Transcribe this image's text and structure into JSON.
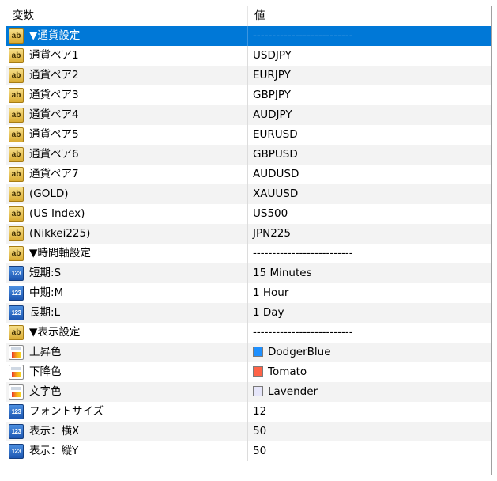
{
  "header": {
    "name_col": "変数",
    "value_col": "値"
  },
  "rows": [
    {
      "icon": "ab-icon",
      "name": "▼通貨設定",
      "value": "--------------------------",
      "selected": true
    },
    {
      "icon": "ab-icon",
      "name": "通貨ペア1",
      "value": "USDJPY"
    },
    {
      "icon": "ab-icon",
      "name": "通貨ペア2",
      "value": "EURJPY"
    },
    {
      "icon": "ab-icon",
      "name": "通貨ペア3",
      "value": "GBPJPY"
    },
    {
      "icon": "ab-icon",
      "name": "通貨ペア4",
      "value": "AUDJPY"
    },
    {
      "icon": "ab-icon",
      "name": "通貨ペア5",
      "value": "EURUSD"
    },
    {
      "icon": "ab-icon",
      "name": "通貨ペア6",
      "value": "GBPUSD"
    },
    {
      "icon": "ab-icon",
      "name": "通貨ペア7",
      "value": "AUDUSD"
    },
    {
      "icon": "ab-icon",
      "name": "(GOLD)",
      "value": "XAUUSD"
    },
    {
      "icon": "ab-icon",
      "name": "(US Index)",
      "value": "US500"
    },
    {
      "icon": "ab-icon",
      "name": "(Nikkei225)",
      "value": "JPN225"
    },
    {
      "icon": "ab-icon",
      "name": "▼時間軸設定",
      "value": "--------------------------"
    },
    {
      "icon": "number-icon",
      "name": "短期:S",
      "value": "15 Minutes"
    },
    {
      "icon": "number-icon",
      "name": "中期:M",
      "value": "1 Hour"
    },
    {
      "icon": "number-icon",
      "name": "長期:L",
      "value": "1 Day"
    },
    {
      "icon": "ab-icon",
      "name": "▼表示設定",
      "value": "--------------------------"
    },
    {
      "icon": "color-icon",
      "name": "上昇色",
      "value": "DodgerBlue",
      "swatch": "#1e90ff"
    },
    {
      "icon": "color-icon",
      "name": "下降色",
      "value": "Tomato",
      "swatch": "#ff6347"
    },
    {
      "icon": "color-icon",
      "name": "文字色",
      "value": "Lavender",
      "swatch": "#e6e6fa"
    },
    {
      "icon": "number-icon",
      "name": "フォントサイズ",
      "value": "12"
    },
    {
      "icon": "number-icon",
      "name": "表示：横X",
      "value": "50"
    },
    {
      "icon": "number-icon",
      "name": "表示：縦Y",
      "value": "50"
    }
  ],
  "colors": {
    "selected_bg": "#0078d7",
    "alt_row_bg": "#f3f3f3"
  }
}
